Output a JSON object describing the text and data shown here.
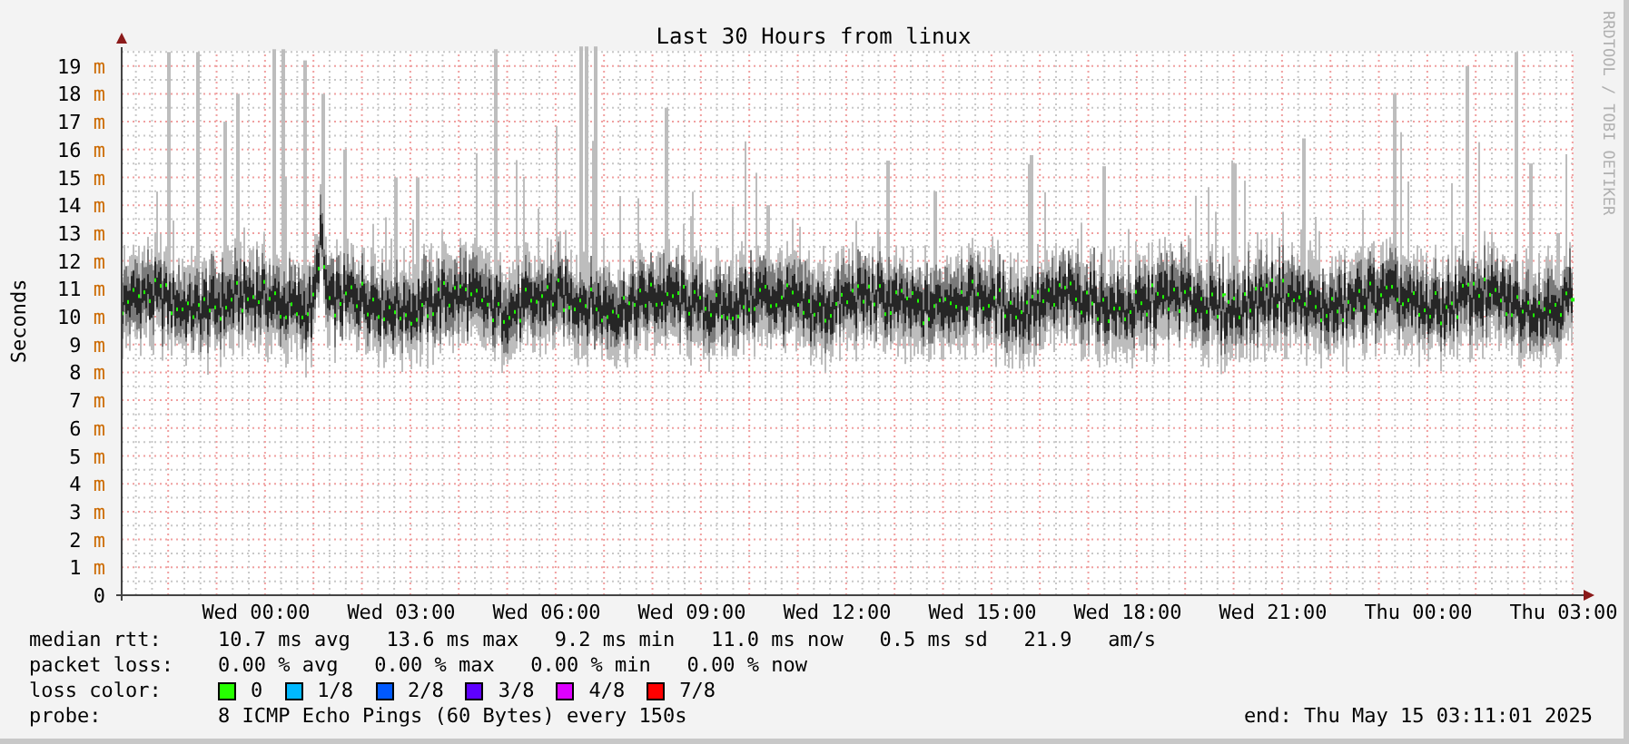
{
  "title": "Last 30 Hours from linux",
  "ylabel": "Seconds",
  "credit": "RRDTOOL / TOBI OETIKER",
  "y_ticks": [
    {
      "value": "19",
      "unit": "m"
    },
    {
      "value": "18",
      "unit": "m"
    },
    {
      "value": "17",
      "unit": "m"
    },
    {
      "value": "16",
      "unit": "m"
    },
    {
      "value": "15",
      "unit": "m"
    },
    {
      "value": "14",
      "unit": "m"
    },
    {
      "value": "13",
      "unit": "m"
    },
    {
      "value": "12",
      "unit": "m"
    },
    {
      "value": "11",
      "unit": "m"
    },
    {
      "value": "10",
      "unit": "m"
    },
    {
      "value": "9",
      "unit": "m"
    },
    {
      "value": "8",
      "unit": "m"
    },
    {
      "value": "7",
      "unit": "m"
    },
    {
      "value": "6",
      "unit": "m"
    },
    {
      "value": "5",
      "unit": "m"
    },
    {
      "value": "4",
      "unit": "m"
    },
    {
      "value": "3",
      "unit": "m"
    },
    {
      "value": "2",
      "unit": "m"
    },
    {
      "value": "1",
      "unit": "m"
    },
    {
      "value": "0"
    }
  ],
  "x_ticks": [
    "Wed 00:00",
    "Wed 03:00",
    "Wed 06:00",
    "Wed 09:00",
    "Wed 12:00",
    "Wed 15:00",
    "Wed 18:00",
    "Wed 21:00",
    "Thu 00:00",
    "Thu 03:00"
  ],
  "legend": {
    "median_rtt": {
      "label": "median rtt:",
      "text": "10.7 ms avg   13.6 ms max   9.2 ms min   11.0 ms now   0.5 ms sd   21.9   am/s"
    },
    "packet_loss": {
      "label": "packet loss:",
      "text": "0.00 % avg   0.00 % max   0.00 % min   0.00 % now"
    },
    "loss_color": {
      "label": "loss color:",
      "items": [
        {
          "label": "0",
          "color": "#26ff00"
        },
        {
          "label": "1/8",
          "color": "#00b8ff"
        },
        {
          "label": "2/8",
          "color": "#0059ff"
        },
        {
          "label": "3/8",
          "color": "#5e00ff"
        },
        {
          "label": "4/8",
          "color": "#dd00ff"
        },
        {
          "label": "7/8",
          "color": "#ff0000"
        }
      ]
    },
    "probe": {
      "label": "probe:",
      "text": "8 ICMP Echo Pings (60 Bytes) every 150s"
    },
    "end": "end: Thu May 15 03:11:01 2025"
  }
}
